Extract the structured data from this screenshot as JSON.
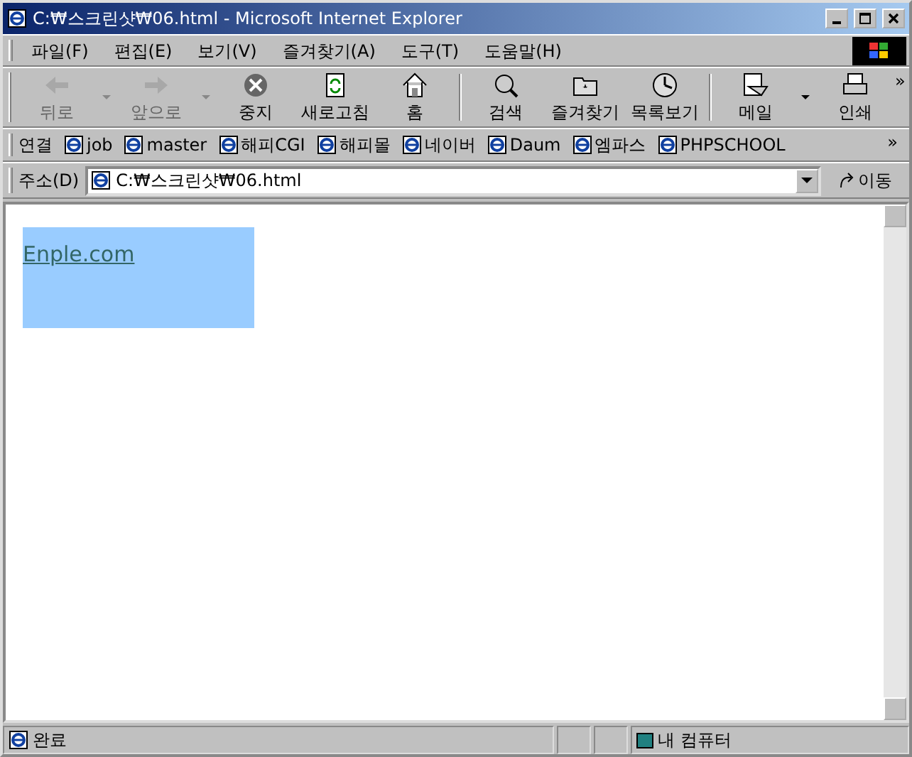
{
  "window": {
    "title": "C:₩스크린샷₩06.html - Microsoft Internet Explorer"
  },
  "menu": [
    "파일(F)",
    "편집(E)",
    "보기(V)",
    "즐겨찾기(A)",
    "도구(T)",
    "도움말(H)"
  ],
  "toolbar": [
    {
      "kind": "back",
      "label": "뒤로",
      "disabled": true,
      "dropdown": true
    },
    {
      "kind": "forward",
      "label": "앞으로",
      "disabled": true,
      "dropdown": true
    },
    {
      "kind": "stop",
      "label": "중지",
      "disabled": false,
      "dropdown": false
    },
    {
      "kind": "refresh",
      "label": "새로고침",
      "disabled": false,
      "dropdown": false
    },
    {
      "kind": "home",
      "label": "홈",
      "disabled": false,
      "dropdown": false
    },
    {
      "kind": "search",
      "label": "검색",
      "disabled": false,
      "dropdown": false
    },
    {
      "kind": "favorites",
      "label": "즐겨찾기",
      "disabled": false,
      "dropdown": false
    },
    {
      "kind": "history",
      "label": "목록보기",
      "disabled": false,
      "dropdown": false
    },
    {
      "kind": "mail",
      "label": "메일",
      "disabled": false,
      "dropdown": true
    },
    {
      "kind": "print",
      "label": "인쇄",
      "disabled": false,
      "dropdown": false
    }
  ],
  "toolbar_more": "»",
  "links_bar": {
    "label": "연결",
    "more": "»",
    "links": [
      "job",
      "master",
      "해피CGI",
      "해피몰",
      "네이버",
      "Daum",
      "엠파스",
      "PHPSCHOOL"
    ]
  },
  "address_bar": {
    "label": "주소(D)",
    "value": "C:₩스크린샷₩06.html",
    "go": "이동"
  },
  "page": {
    "link": "Enple.com"
  },
  "status_bar": {
    "text": "완료",
    "zone": "내 컴퓨터"
  }
}
